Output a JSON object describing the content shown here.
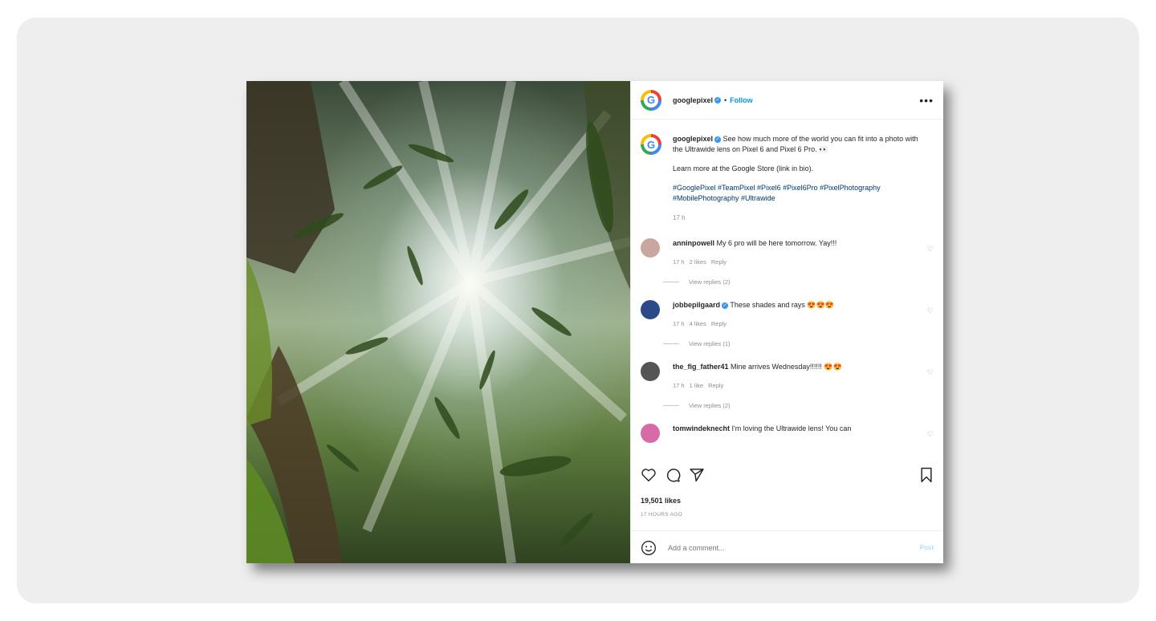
{
  "header": {
    "username": "googlepixel",
    "dot": "•",
    "follow": "Follow",
    "more": "•••"
  },
  "caption": {
    "username": "googlepixel",
    "text": " See how much more of the world you can fit into a photo with the Ultrawide lens on Pixel 6 and Pixel 6 Pro. 👀",
    "learn_more": "Learn more at the Google Store (link in bio).",
    "hashtags": "#GooglePixel #TeamPixel #Pixel6 #Pixel6Pro #PixelPhotography #MobilePhotography #Ultrawide",
    "time": "17 h"
  },
  "comments": [
    {
      "user": "anninpowell",
      "text": "My 6 pro will be here tomorrow. Yay!!!",
      "time": "17 h",
      "likes": "2 likes",
      "reply": "Reply",
      "view_replies": "View replies (2)",
      "avatar_color": "#c9a7a0"
    },
    {
      "user": "jobbepilgaard",
      "text": "These shades and rays 😍😍😍",
      "time": "17 h",
      "likes": "4 likes",
      "reply": "Reply",
      "view_replies": "View replies (1)",
      "avatar_color": "#2c4a8a"
    },
    {
      "user": "the_fig_father41",
      "text": "Mine arrives Wednesday!!!!!! 😍😍",
      "time": "17 h",
      "likes": "1 like",
      "reply": "Reply",
      "view_replies": "View replies (2)",
      "avatar_color": "#555555"
    },
    {
      "user": "tomwindeknecht",
      "text": "I'm loving the Ultrawide lens! You can",
      "avatar_color": "#d96aa8"
    }
  ],
  "likes": "19,501 likes",
  "time_ago": "17 HOURS AGO",
  "add_comment": {
    "placeholder": "Add a comment...",
    "post": "Post"
  },
  "logo_letter": "G"
}
